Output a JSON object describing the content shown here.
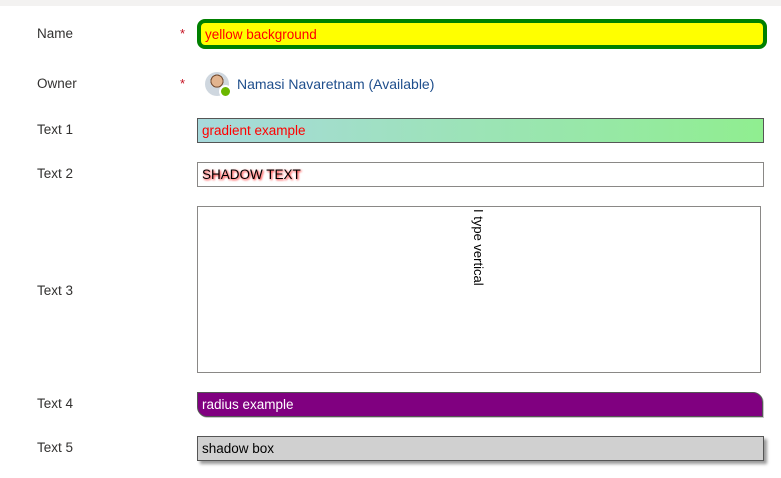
{
  "form": {
    "name": {
      "label": "Name",
      "required": "*",
      "value": "yellow background"
    },
    "owner": {
      "label": "Owner",
      "required": "*",
      "value": "Namasi Navaretnam (Available)",
      "avatar_icon": "user-avatar-icon",
      "presence_color": "#6bb700"
    },
    "text1": {
      "label": "Text 1",
      "value": "gradient example"
    },
    "text2": {
      "label": "Text 2",
      "value": "SHADOW TEXT"
    },
    "text3": {
      "label": "Text 3",
      "value": "I type vertical"
    },
    "text4": {
      "label": "Text 4",
      "value": "radius example"
    },
    "text5": {
      "label": "Text 5",
      "value": "shadow box"
    }
  },
  "colors": {
    "name_background": "#ffff00",
    "name_border": "#008000",
    "name_text": "#ff0000",
    "gradient_start": "#a7d9dc",
    "gradient_end": "#90ee90",
    "radius_background": "#800080",
    "shadow_box_background": "#d0d0d0",
    "owner_link": "#1e4e8c",
    "required_marker": "#c50f1f"
  }
}
